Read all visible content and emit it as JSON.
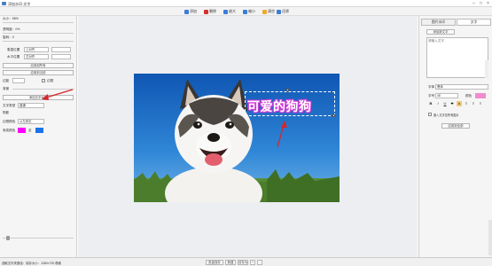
{
  "window": {
    "title": "添加水印-文字"
  },
  "toolbar": {
    "items": [
      {
        "label": "添加",
        "icon": "add-icon",
        "color": "#3b7dd8"
      },
      {
        "label": "删除",
        "icon": "delete-icon",
        "color": "#d32f2f"
      },
      {
        "label": "放大",
        "icon": "zoom-in-icon",
        "color": "#3b7dd8"
      },
      {
        "label": "缩小",
        "icon": "zoom-out-icon",
        "color": "#3b7dd8"
      },
      {
        "label": "清空",
        "icon": "clear-icon",
        "color": "#f0a830"
      },
      {
        "label": "还原",
        "icon": "restore-icon",
        "color": "#3b7dd8"
      }
    ]
  },
  "left": {
    "size": "大小：",
    "size_val": "58%",
    "opacity": "透明度：",
    "opacity_val": "0%",
    "rotate": "旋转：",
    "rotate_val": "0",
    "pos_h": "垂直位置",
    "pos_h_val": "上对齐",
    "pos_v": "水平位置",
    "pos_v_val": "左对齐",
    "apply_all": "应用到所有",
    "apply_cur": "应用到当前",
    "margin": "边距",
    "margin_chk": "边框",
    "bg": "背景",
    "add_text_btn": "添加文字水印",
    "text_type": "文字类型",
    "text_type_val": "普通",
    "shadow": "阴影",
    "border_color": "边框颜色",
    "border_color_val": "从左到右",
    "gradient": "渐变颜色",
    "gradient_to": "至",
    "color_a": "#ff00ff",
    "color_b": "#1a73e8"
  },
  "canvas": {
    "watermark": "可爱的狗狗"
  },
  "right": {
    "tab_image": "图片水印",
    "tab_text": "文字",
    "add_text_btn": "添加新文字",
    "placeholder": "请输入文字",
    "font": "字体",
    "font_val": "黑体",
    "font_size": "字号",
    "font_size_val": "48",
    "color": "颜色",
    "color_val": "#f08ccb",
    "fmt": [
      "B",
      "I",
      "U",
      "S",
      "A",
      "≡",
      "≡",
      "≡"
    ],
    "chk_label": "嵌入文字至所有图片",
    "apply_btn": "应用到全部"
  },
  "status": {
    "left": "选取文件夹路径：保存大小：1280×720 像素",
    "buttons": [
      "批量保存",
      "新建",
      "另存为",
      "+",
      "-"
    ]
  }
}
